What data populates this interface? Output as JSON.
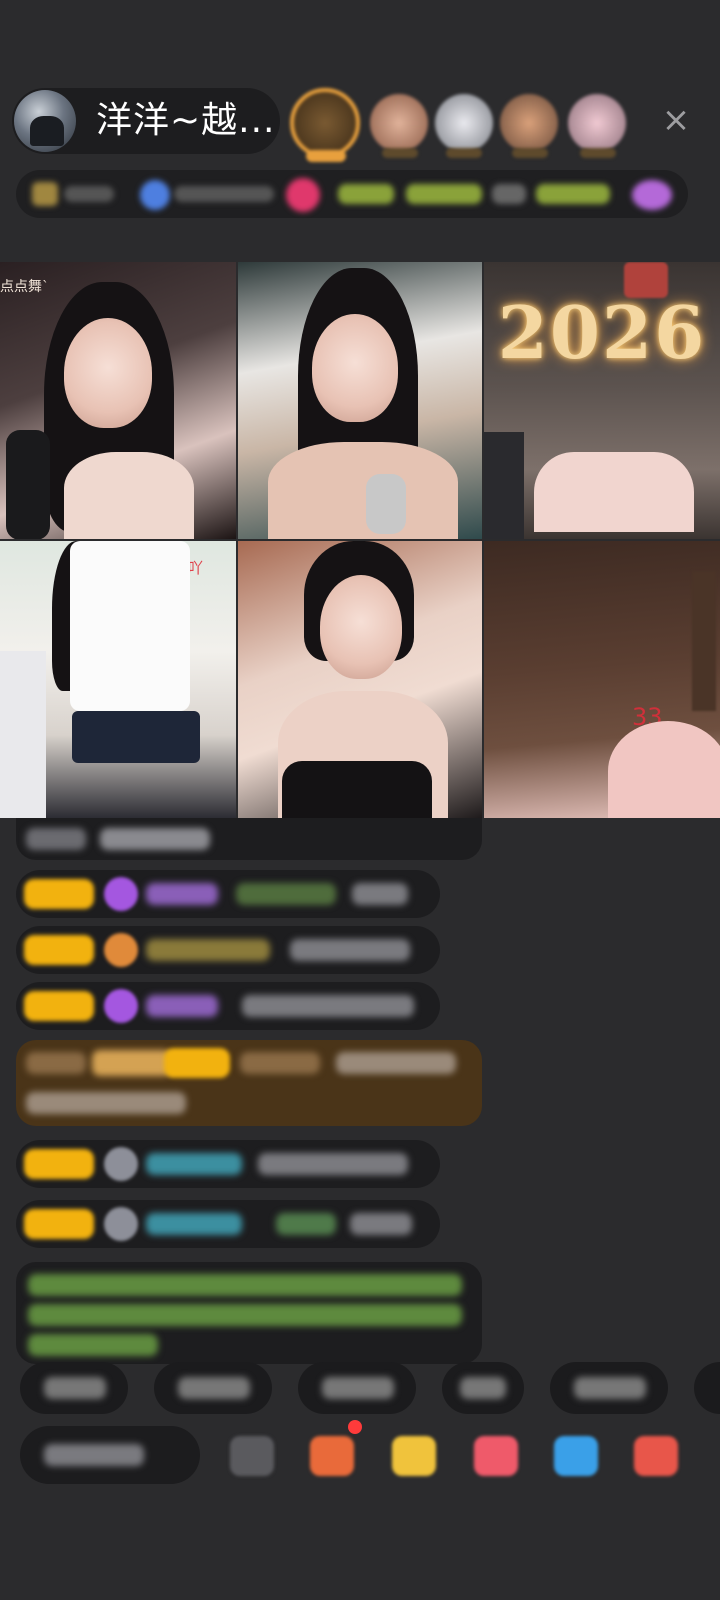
{
  "header": {
    "host_name": "洋洋~越...",
    "close_icon": "×",
    "accent_color": "#e8a03d"
  },
  "video_tiles": {
    "tile1_caption": "点点舞`",
    "tile3_banner": "2026",
    "tile4_caption": "众筹升级吖",
    "tile6_counter": "33"
  },
  "colors": {
    "badge_yellow": "#f2b20f",
    "gem_purple": "#9f4bd8",
    "chat_highlight": "#4a3418",
    "notice_text_green": "#9ad26a"
  },
  "icons": {
    "close": "close-icon",
    "search": "search-icon",
    "gift": "gift-icon",
    "game": "game-icon",
    "more": "more-icon",
    "emoji": "emoji-icon"
  }
}
